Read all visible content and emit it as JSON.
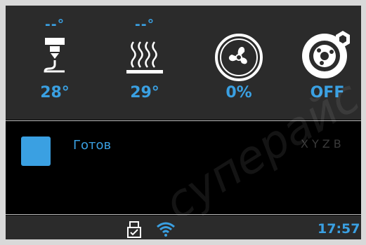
{
  "hotend": {
    "target": "--°",
    "current": "28°",
    "icon": "hotend-nozzle-icon"
  },
  "bed": {
    "target": "--°",
    "current": "29°",
    "icon": "heated-bed-icon"
  },
  "fan": {
    "value": "0%",
    "icon": "fan-icon"
  },
  "filament": {
    "value": "OFF",
    "icon": "filament-spool-icon"
  },
  "status": {
    "text": "Готов",
    "axes": "XYZB"
  },
  "bottom_bar": {
    "time": "17:57",
    "usb_icon": "usb-drive-icon",
    "wifi_icon": "wifi-icon"
  },
  "watermark": "суперайс",
  "colors": {
    "accent": "#3aa0e2",
    "panel": "#2b2b2b",
    "background": "#000000"
  }
}
